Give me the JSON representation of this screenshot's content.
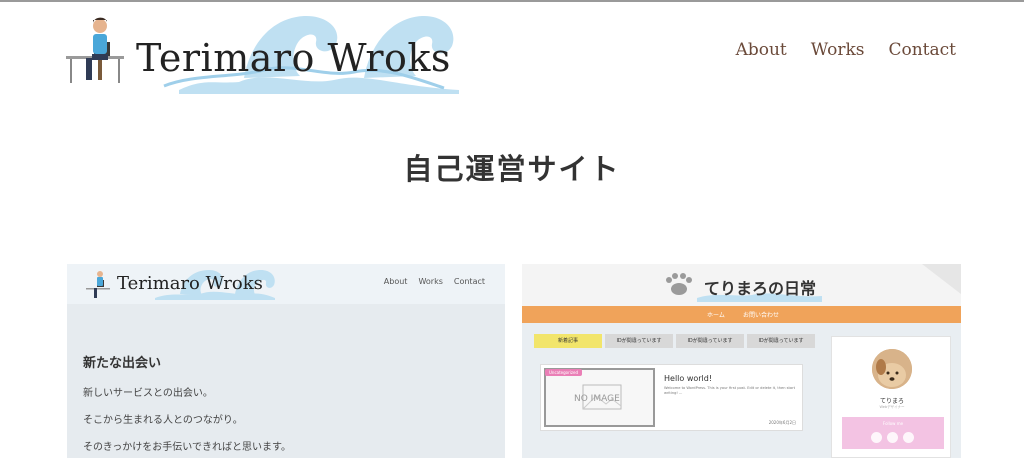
{
  "header": {
    "logo_text": "Terimaro Wroks",
    "nav": [
      "About",
      "Works",
      "Contact"
    ]
  },
  "section_title": "自己運営サイト",
  "works": [
    {
      "logo_text": "Terimaro Wroks",
      "nav": [
        "About",
        "Works",
        "Contact"
      ],
      "heading": "新たな出会い",
      "lines": [
        "新しいサービスとの出会い。",
        "そこから生まれる人とのつながり。",
        "そのきっかけをお手伝いできればと思います。"
      ]
    },
    {
      "site_title": "てりまろの日常",
      "nav": [
        "ホーム",
        "お問い合わせ"
      ],
      "tabs": [
        "新着記事",
        "IDが間違っています",
        "IDが間違っています",
        "IDが間違っています"
      ],
      "post": {
        "no_image": "NO IMAGE",
        "category": "Uncategorized",
        "title": "Hello world!",
        "excerpt": "Welcome to WordPress. This is your first post. Edit or delete it, then start writing! ...",
        "date": "2020年6月2日"
      },
      "profile": {
        "name": "てりまろ",
        "subtitle": "Webデザイナー",
        "follow_label": "Follow me"
      }
    }
  ],
  "colors": {
    "accent_brown": "#6b4a3a",
    "wave_blue": "#bfe0f2",
    "nav_orange": "#f0a35a",
    "tab_yellow": "#f2e56b",
    "follow_pink": "#f3c3e3"
  }
}
